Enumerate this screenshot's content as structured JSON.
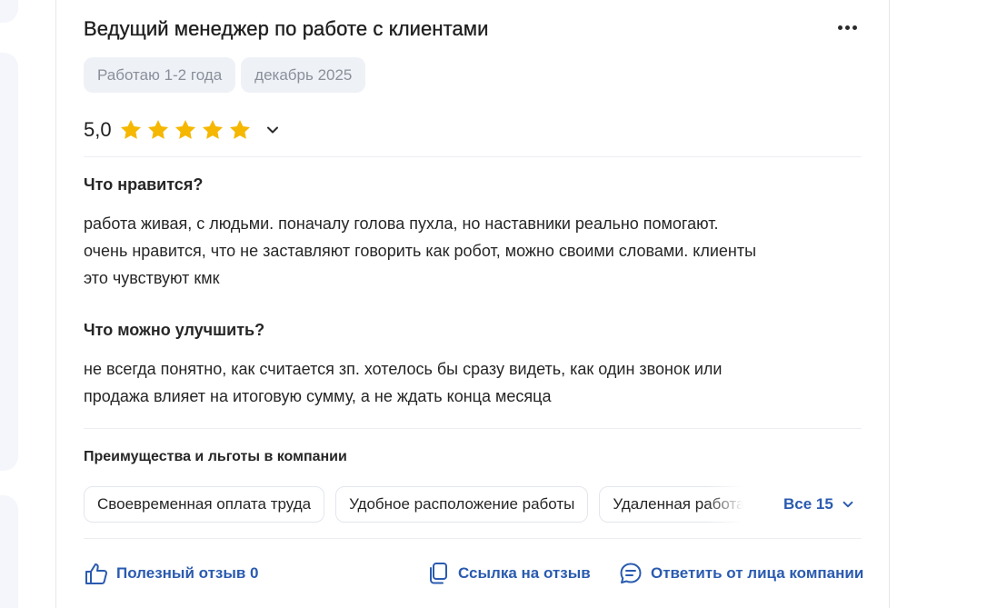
{
  "review": {
    "title": "Ведущий менеджер по работе с клиентами",
    "tags": [
      "Работаю 1-2 года",
      "декабрь 2025"
    ],
    "rating": {
      "value_text": "5,0",
      "stars": 5,
      "max": 5
    },
    "likes": {
      "heading": "Что нравится?",
      "lines": [
        "работа живая, с людьми. поначалу голова пухла, но наставники реально помогают.",
        "очень нравится, что не заставляют говорить как робот, можно своими словами. клиенты",
        "это чувствуют кмк"
      ]
    },
    "improve": {
      "heading": "Что можно улучшить?",
      "lines": [
        "не всегда понятно, как считается зп. хотелось бы сразу видеть, как один звонок или",
        "продажа влияет на итоговую сумму, а не ждать конца месяца"
      ]
    },
    "benefits": {
      "heading": "Преимущества и льготы в компании",
      "items": [
        "Своевременная оплата труда",
        "Удобное расположение работы",
        "Удаленная работа"
      ],
      "all_label": "Все 15"
    },
    "actions": {
      "useful": "Полезный отзыв 0",
      "link": "Ссылка на отзыв",
      "reply": "Ответить от лица компании"
    }
  },
  "colors": {
    "accent": "#2a5bb0",
    "star": "#f5b700",
    "chip_bg": "#eef1f6"
  },
  "icons": [
    "more-icon",
    "star-icon",
    "chevron-down-icon",
    "thumbs-up-icon",
    "copy-link-icon",
    "reply-icon"
  ]
}
